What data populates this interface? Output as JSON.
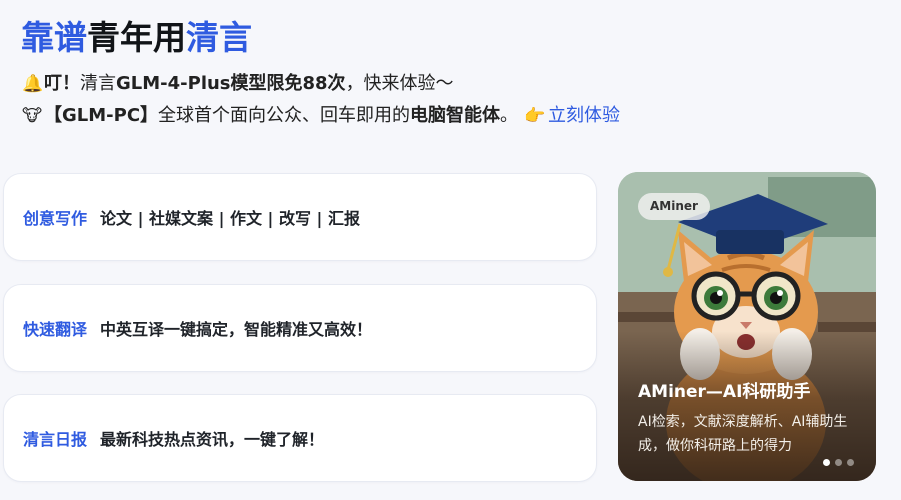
{
  "headline": {
    "part1": "靠谱",
    "part2": "青年用",
    "part3": "清言"
  },
  "notices": [
    {
      "icon": "bell-icon",
      "emoji": "🔔",
      "prefix": "叮！",
      "text1": "清言",
      "bold": "GLM-4-Plus模型限免88次",
      "text2": "，快来体验～"
    },
    {
      "icon": "cow-icon",
      "emoji": "🐮",
      "prefix": "【GLM-PC】",
      "text1": "全球首个面向公众、回车即用的",
      "bold": "电脑智能体",
      "text2": "。",
      "pointer": "👉",
      "link": "立刻体验"
    }
  ],
  "cards": [
    {
      "title": "创意写作",
      "desc": "论文 | 社媒文案 | 作文 | 改写 | 汇报"
    },
    {
      "title": "快速翻译",
      "desc": "中英互译一键搞定，智能精准又高效！"
    },
    {
      "title": "清言日报",
      "desc": "最新科技热点资讯，一键了解！"
    }
  ],
  "promo": {
    "badge": "AMiner",
    "title": "AMiner—AI科研助手",
    "desc": "AI检索，文献深度解析、AI辅助生成，做你科研路上的得力",
    "slides_total": 3,
    "slide_active": 1
  },
  "colors": {
    "accent": "#2f5be0",
    "background": "#f6f7fb",
    "card": "#ffffff"
  }
}
